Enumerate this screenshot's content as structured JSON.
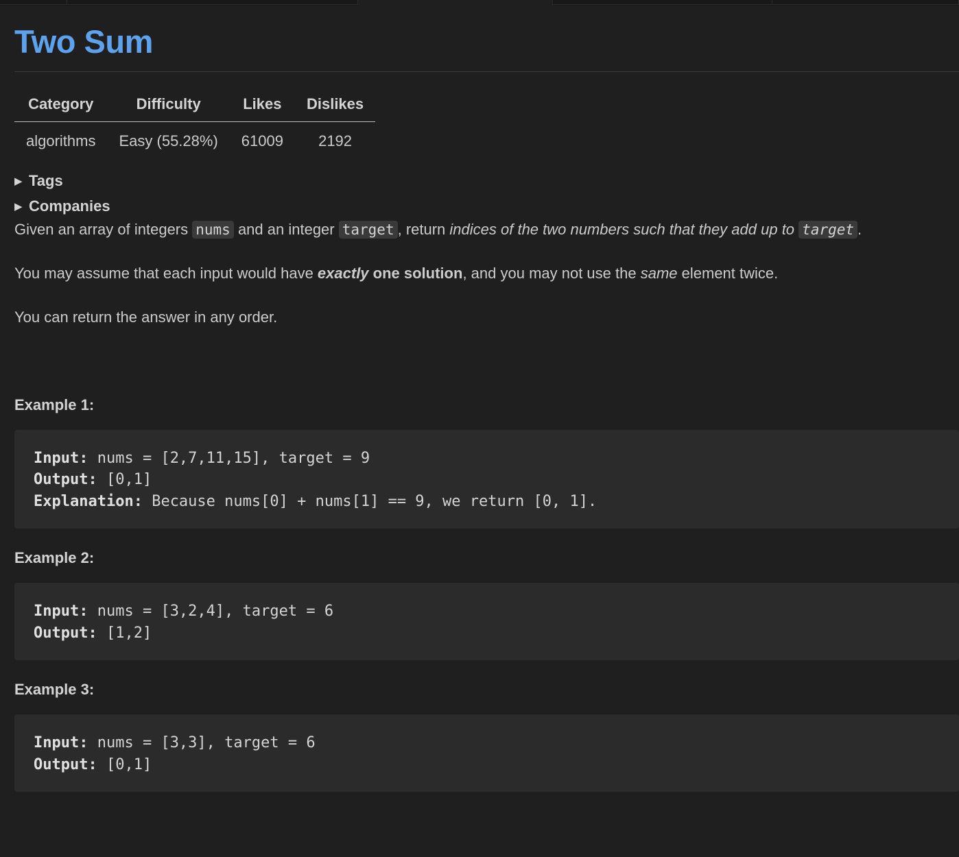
{
  "problem": {
    "title": "Two Sum"
  },
  "meta_table": {
    "headers": [
      "Category",
      "Difficulty",
      "Likes",
      "Dislikes"
    ],
    "values": [
      "algorithms",
      "Easy (55.28%)",
      "61009",
      "2192"
    ]
  },
  "disclosures": [
    {
      "label": "Tags"
    },
    {
      "label": "Companies"
    }
  ],
  "description": {
    "p1": {
      "t1": "Given an array of integers ",
      "c1": "nums",
      "t2": " and an integer ",
      "c2": "target",
      "t3": ", return ",
      "em": "indices of the two numbers such that they add up to",
      "t4": " ",
      "c3": "target",
      "t5": "."
    },
    "p2": {
      "t1": "You may assume that each input would have ",
      "b1": "exactly",
      "b2": " one solution",
      "t2": ", and you may not use the ",
      "em": "same",
      "t3": " element twice."
    },
    "p3": "You can return the answer in any order."
  },
  "examples": [
    {
      "title": "Example 1:",
      "input_label": "Input:",
      "input": " nums = [2,7,11,15], target = 9",
      "output_label": "Output:",
      "output": " [0,1]",
      "explanation_label": "Explanation:",
      "explanation": " Because nums[0] + nums[1] == 9, we return [0, 1]."
    },
    {
      "title": "Example 2:",
      "input_label": "Input:",
      "input": " nums = [3,2,4], target = 6",
      "output_label": "Output:",
      "output": " [1,2]"
    },
    {
      "title": "Example 3:",
      "input_label": "Input:",
      "input": " nums = [3,3], target = 6",
      "output_label": "Output:",
      "output": " [0,1]"
    }
  ],
  "colors": {
    "title": "#5ea2ee",
    "background": "#1f1f1f",
    "code_block": "#2b2b2b",
    "inline_code": "#3a3a3a"
  }
}
